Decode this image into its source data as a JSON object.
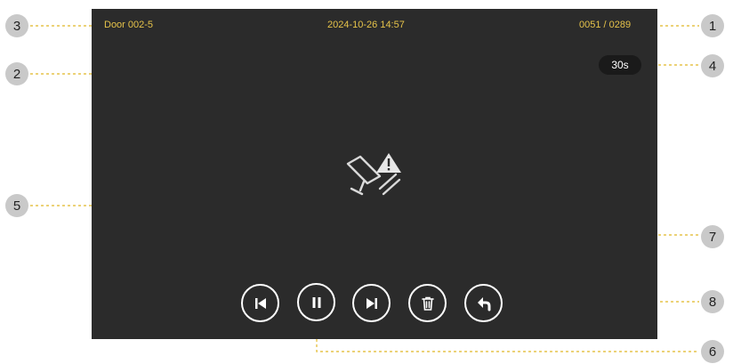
{
  "header": {
    "door_name": "Door 002-5",
    "datetime": "2024-10-26  14:57",
    "record_counter": "0051 / 0289"
  },
  "timer": {
    "label": "30s"
  },
  "controls": {
    "previous_icon": "skip-previous-icon",
    "pause_icon": "pause-icon",
    "next_icon": "skip-next-icon",
    "delete_icon": "trash-icon",
    "back_icon": "return-arrow-icon"
  },
  "status": {
    "icon": "camera-warning-icon"
  },
  "callouts": [
    "1",
    "2",
    "3",
    "4",
    "5",
    "6",
    "7",
    "8"
  ],
  "colors": {
    "screen_bg": "#2b2b2b",
    "accent": "#e6c34a",
    "control_stroke": "#ffffff",
    "callout_bg": "#c9c9c9"
  }
}
